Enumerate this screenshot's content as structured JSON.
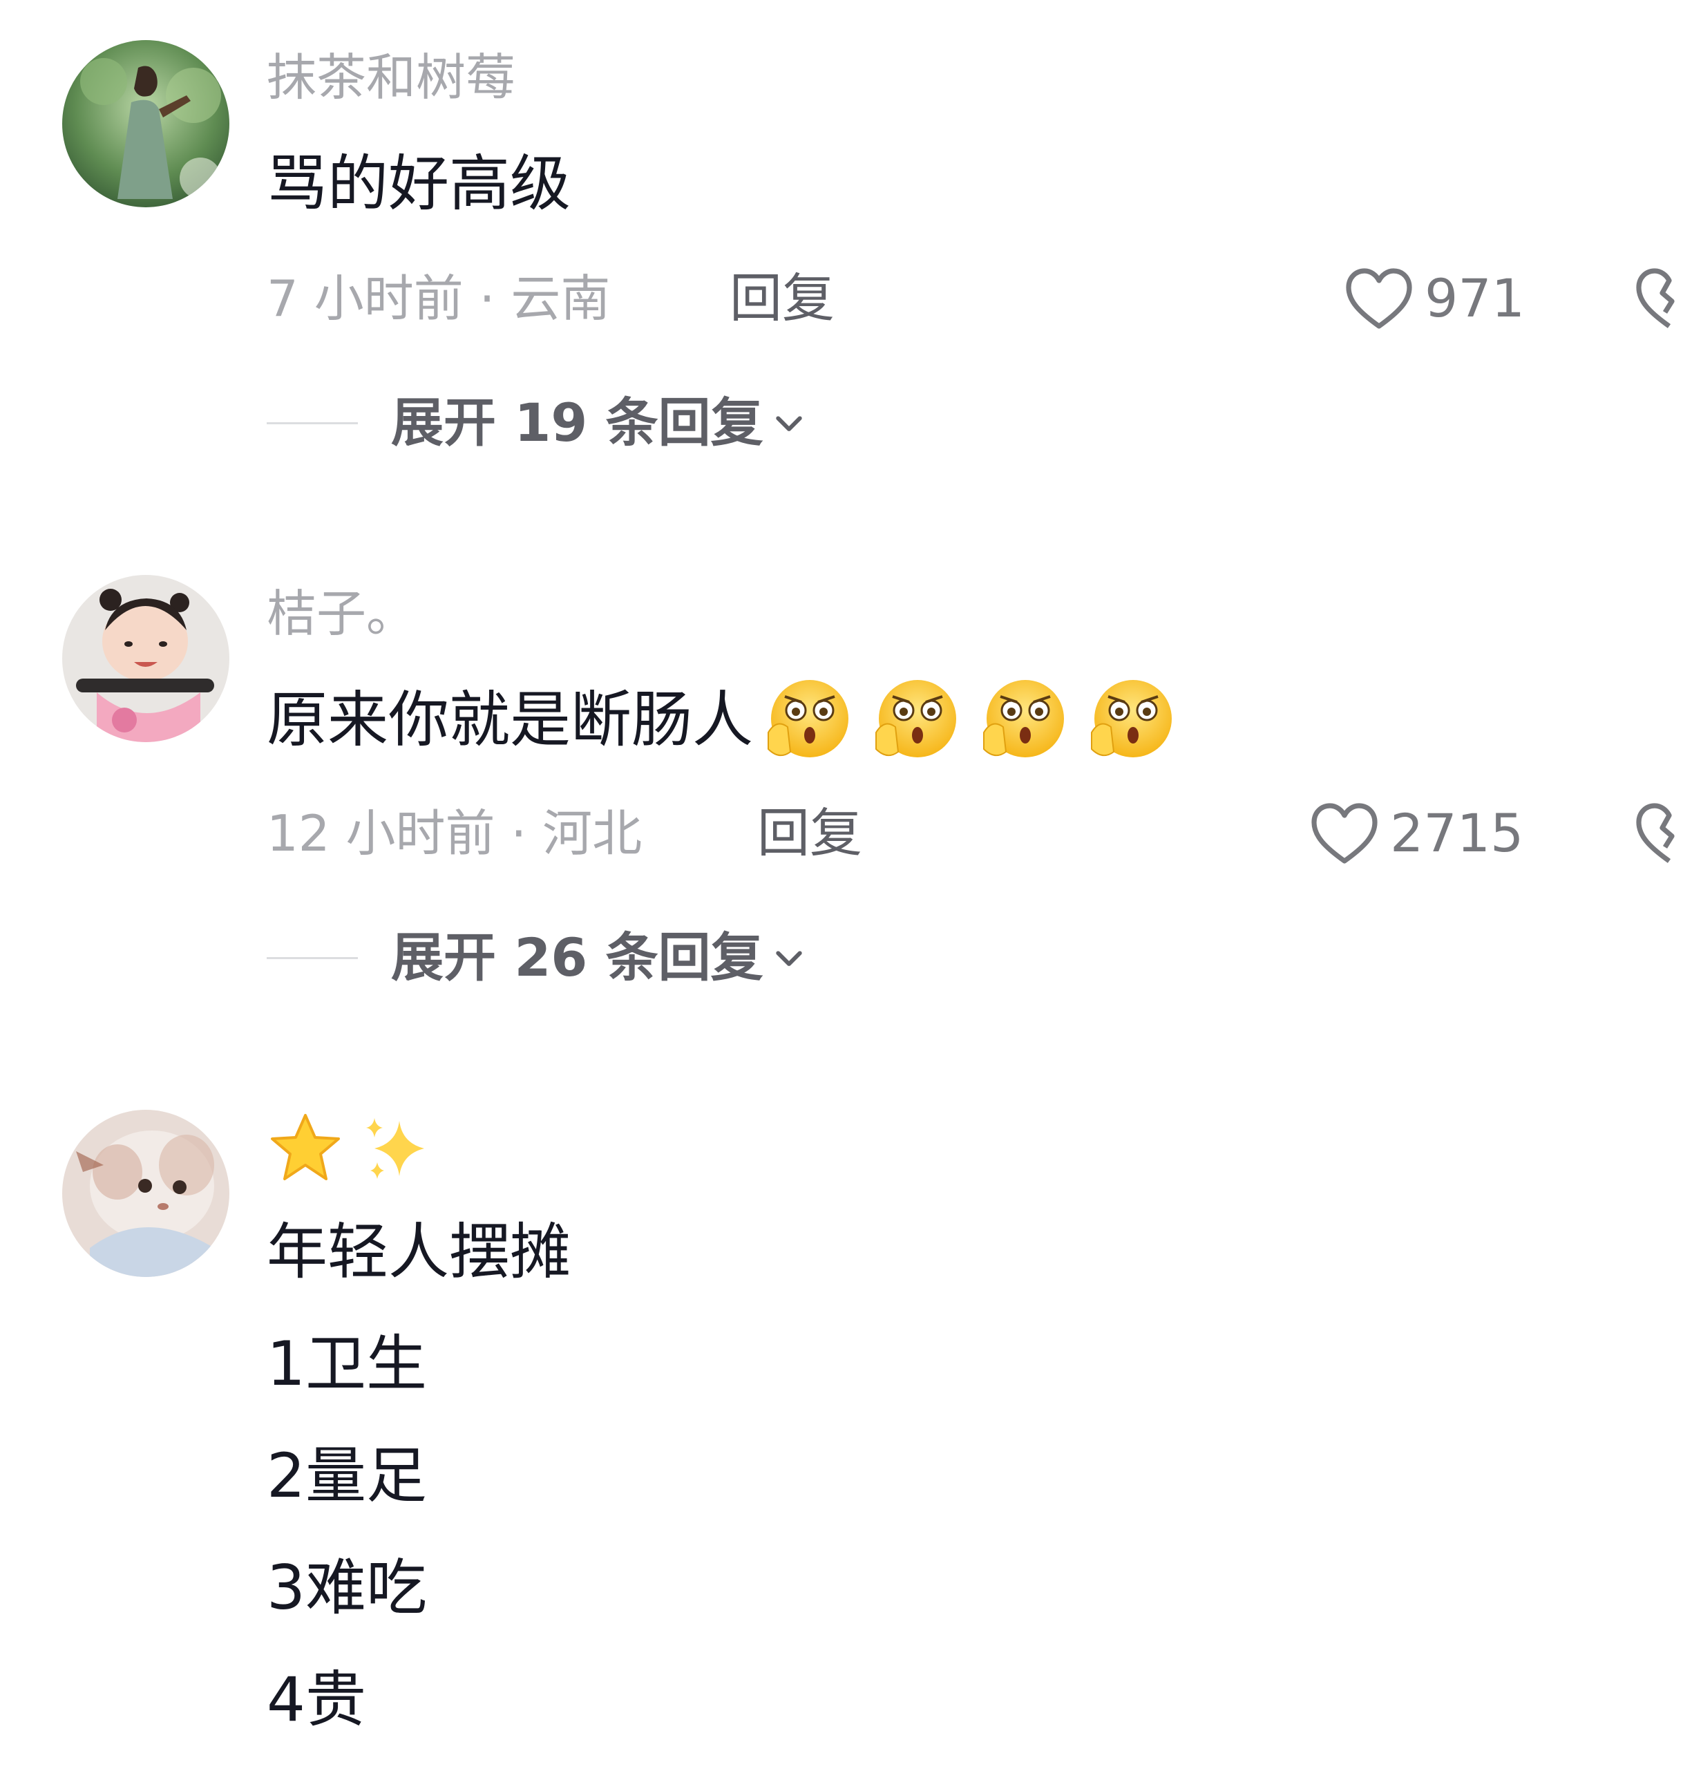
{
  "comments": [
    {
      "username": "抹茶和树莓",
      "content": [
        "骂的好高级"
      ],
      "meta": "7 小时前 · 云南",
      "reply_label": "回复",
      "likes": "971",
      "expand": "展开 19 条回复"
    },
    {
      "username": "桔子。",
      "content": [
        "原来你就是断肠人"
      ],
      "emoji_icons": [
        "shocked-face-icon",
        "shocked-face-icon",
        "shocked-face-icon",
        "shocked-face-icon"
      ],
      "meta": "12 小时前 · 河北",
      "reply_label": "回复",
      "likes": "2715",
      "expand": "展开 26 条回复"
    },
    {
      "username_icons": [
        "star-icon",
        "sparkles-icon"
      ],
      "content": [
        "年轻人摆摊",
        "1卫生",
        "2量足",
        "3难吃",
        "4贵"
      ]
    }
  ],
  "colors": {
    "username": "#a7a8ad",
    "text": "#161823",
    "reply": "#5e5f66",
    "heart_stroke": "#77787d",
    "emoji_yellow": "#ffcf33"
  }
}
